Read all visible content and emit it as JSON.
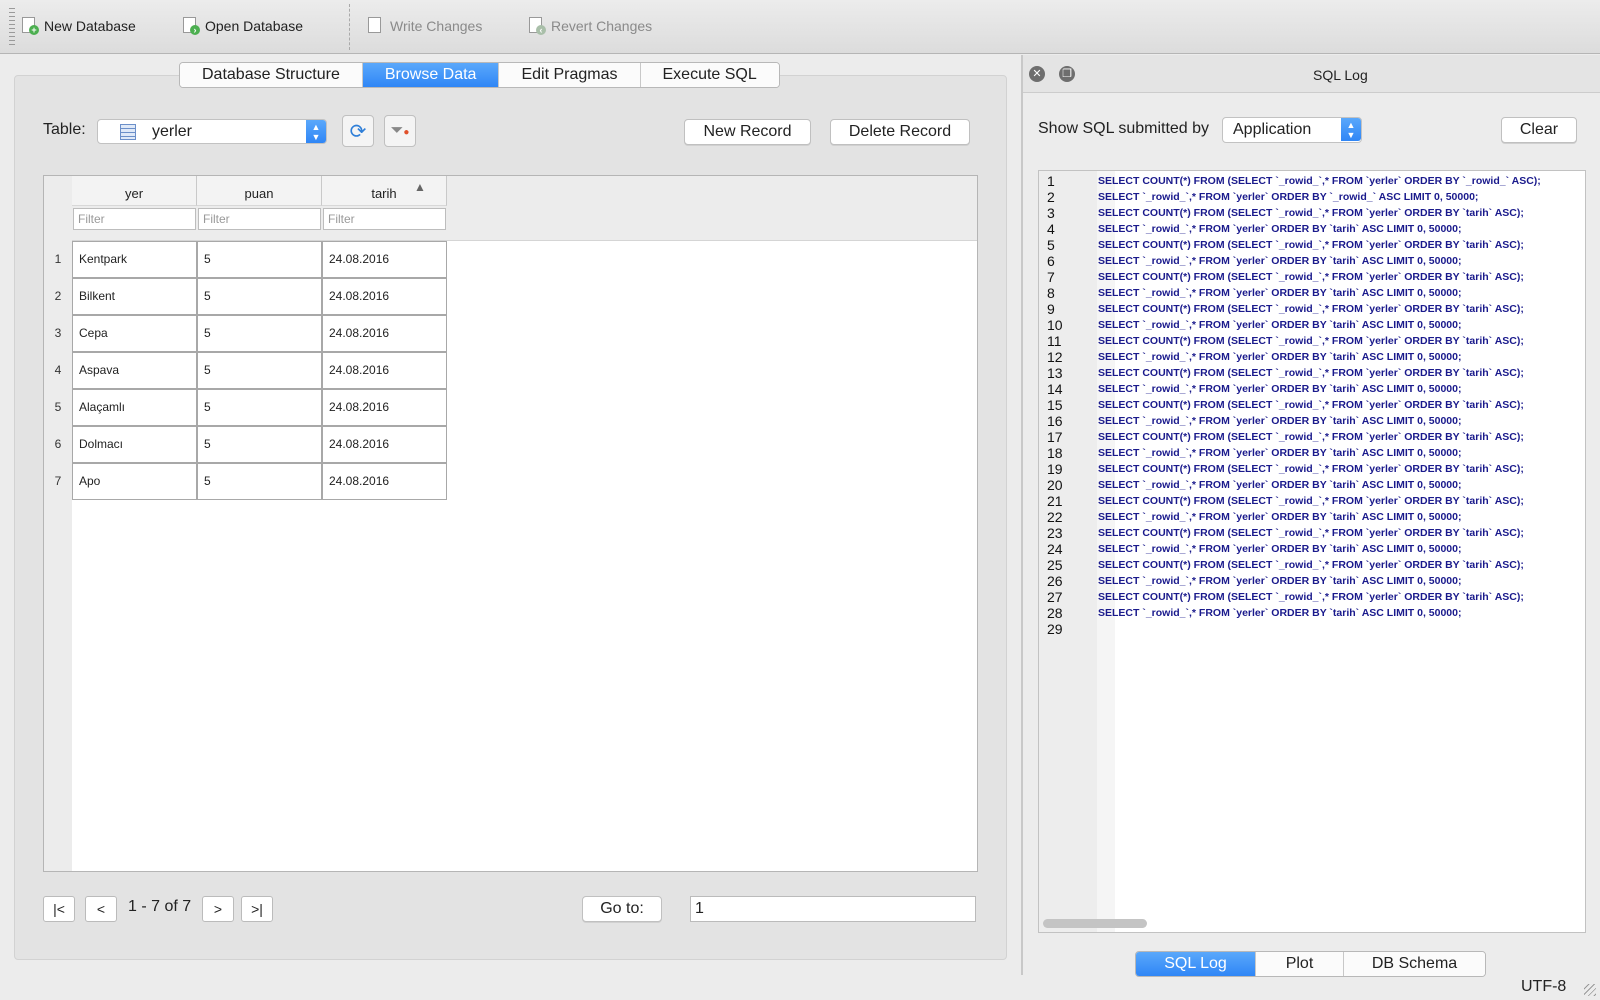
{
  "toolbar": {
    "new_database": "New Database",
    "open_database": "Open Database",
    "write_changes": "Write Changes",
    "revert_changes": "Revert Changes"
  },
  "tabs": [
    "Database Structure",
    "Browse Data",
    "Edit Pragmas",
    "Execute SQL"
  ],
  "active_tab": "Browse Data",
  "browse": {
    "table_label": "Table:",
    "table_selected": "yerler",
    "new_record": "New Record",
    "delete_record": "Delete Record",
    "columns": [
      "yer",
      "puan",
      "tarih"
    ],
    "sorted_column": "tarih",
    "filter_placeholder": "Filter",
    "rows": [
      {
        "num": "1",
        "yer": "Kentpark",
        "puan": "5",
        "tarih": "24.08.2016"
      },
      {
        "num": "2",
        "yer": "Bilkent",
        "puan": "5",
        "tarih": "24.08.2016"
      },
      {
        "num": "3",
        "yer": "Cepa",
        "puan": "5",
        "tarih": "24.08.2016"
      },
      {
        "num": "4",
        "yer": "Aspava",
        "puan": "5",
        "tarih": "24.08.2016"
      },
      {
        "num": "5",
        "yer": "Alaçamlı",
        "puan": "5",
        "tarih": "24.08.2016"
      },
      {
        "num": "6",
        "yer": "Dolmacı",
        "puan": "5",
        "tarih": "24.08.2016"
      },
      {
        "num": "7",
        "yer": "Apo",
        "puan": "5",
        "tarih": "24.08.2016"
      }
    ],
    "nav": {
      "first": "|<",
      "prev": "<",
      "info": "1 - 7 of 7",
      "next": ">",
      "last": ">|",
      "goto_label": "Go to:",
      "goto_value": "1"
    }
  },
  "sql_log": {
    "title": "SQL Log",
    "show_label": "Show SQL submitted by",
    "submitted_by": "Application",
    "clear": "Clear",
    "lines": [
      "SELECT COUNT(*) FROM (SELECT `_rowid_`,* FROM `yerler` ORDER BY `_rowid_` ASC);",
      "SELECT `_rowid_`,* FROM `yerler` ORDER BY `_rowid_` ASC LIMIT 0, 50000;",
      "SELECT COUNT(*) FROM (SELECT `_rowid_`,* FROM `yerler` ORDER BY `tarih` ASC);",
      "SELECT `_rowid_`,* FROM `yerler` ORDER BY `tarih` ASC LIMIT 0, 50000;",
      "SELECT COUNT(*) FROM (SELECT `_rowid_`,* FROM `yerler` ORDER BY `tarih` ASC);",
      "SELECT `_rowid_`,* FROM `yerler` ORDER BY `tarih` ASC LIMIT 0, 50000;",
      "SELECT COUNT(*) FROM (SELECT `_rowid_`,* FROM `yerler` ORDER BY `tarih` ASC);",
      "SELECT `_rowid_`,* FROM `yerler` ORDER BY `tarih` ASC LIMIT 0, 50000;",
      "SELECT COUNT(*) FROM (SELECT `_rowid_`,* FROM `yerler` ORDER BY `tarih` ASC);",
      "SELECT `_rowid_`,* FROM `yerler` ORDER BY `tarih` ASC LIMIT 0, 50000;",
      "SELECT COUNT(*) FROM (SELECT `_rowid_`,* FROM `yerler` ORDER BY `tarih` ASC);",
      "SELECT `_rowid_`,* FROM `yerler` ORDER BY `tarih` ASC LIMIT 0, 50000;",
      "SELECT COUNT(*) FROM (SELECT `_rowid_`,* FROM `yerler` ORDER BY `tarih` ASC);",
      "SELECT `_rowid_`,* FROM `yerler` ORDER BY `tarih` ASC LIMIT 0, 50000;",
      "SELECT COUNT(*) FROM (SELECT `_rowid_`,* FROM `yerler` ORDER BY `tarih` ASC);",
      "SELECT `_rowid_`,* FROM `yerler` ORDER BY `tarih` ASC LIMIT 0, 50000;",
      "SELECT COUNT(*) FROM (SELECT `_rowid_`,* FROM `yerler` ORDER BY `tarih` ASC);",
      "SELECT `_rowid_`,* FROM `yerler` ORDER BY `tarih` ASC LIMIT 0, 50000;",
      "SELECT COUNT(*) FROM (SELECT `_rowid_`,* FROM `yerler` ORDER BY `tarih` ASC);",
      "SELECT `_rowid_`,* FROM `yerler` ORDER BY `tarih` ASC LIMIT 0, 50000;",
      "SELECT COUNT(*) FROM (SELECT `_rowid_`,* FROM `yerler` ORDER BY `tarih` ASC);",
      "SELECT `_rowid_`,* FROM `yerler` ORDER BY `tarih` ASC LIMIT 0, 50000;",
      "SELECT COUNT(*) FROM (SELECT `_rowid_`,* FROM `yerler` ORDER BY `tarih` ASC);",
      "SELECT `_rowid_`,* FROM `yerler` ORDER BY `tarih` ASC LIMIT 0, 50000;",
      "SELECT COUNT(*) FROM (SELECT `_rowid_`,* FROM `yerler` ORDER BY `tarih` ASC);",
      "SELECT `_rowid_`,* FROM `yerler` ORDER BY `tarih` ASC LIMIT 0, 50000;",
      "SELECT COUNT(*) FROM (SELECT `_rowid_`,* FROM `yerler` ORDER BY `tarih` ASC);",
      "SELECT `_rowid_`,* FROM `yerler` ORDER BY `tarih` ASC LIMIT 0, 50000;",
      ""
    ]
  },
  "bottom_tabs": [
    "SQL Log",
    "Plot",
    "DB Schema"
  ],
  "bottom_active": "SQL Log",
  "status": {
    "encoding": "UTF-8"
  },
  "colors": {
    "accent": "#2f86f6",
    "sql_keyword": "#1a1a8c",
    "sql_ident": "#7a2e8c",
    "sql_number": "#0a8a8a"
  },
  "icons": {
    "new_db": "new-database-icon",
    "open_db": "open-database-icon",
    "write": "write-changes-icon",
    "revert": "revert-changes-icon",
    "refresh": "refresh-icon",
    "clear_filter": "clear-filter-icon",
    "table": "table-icon"
  }
}
